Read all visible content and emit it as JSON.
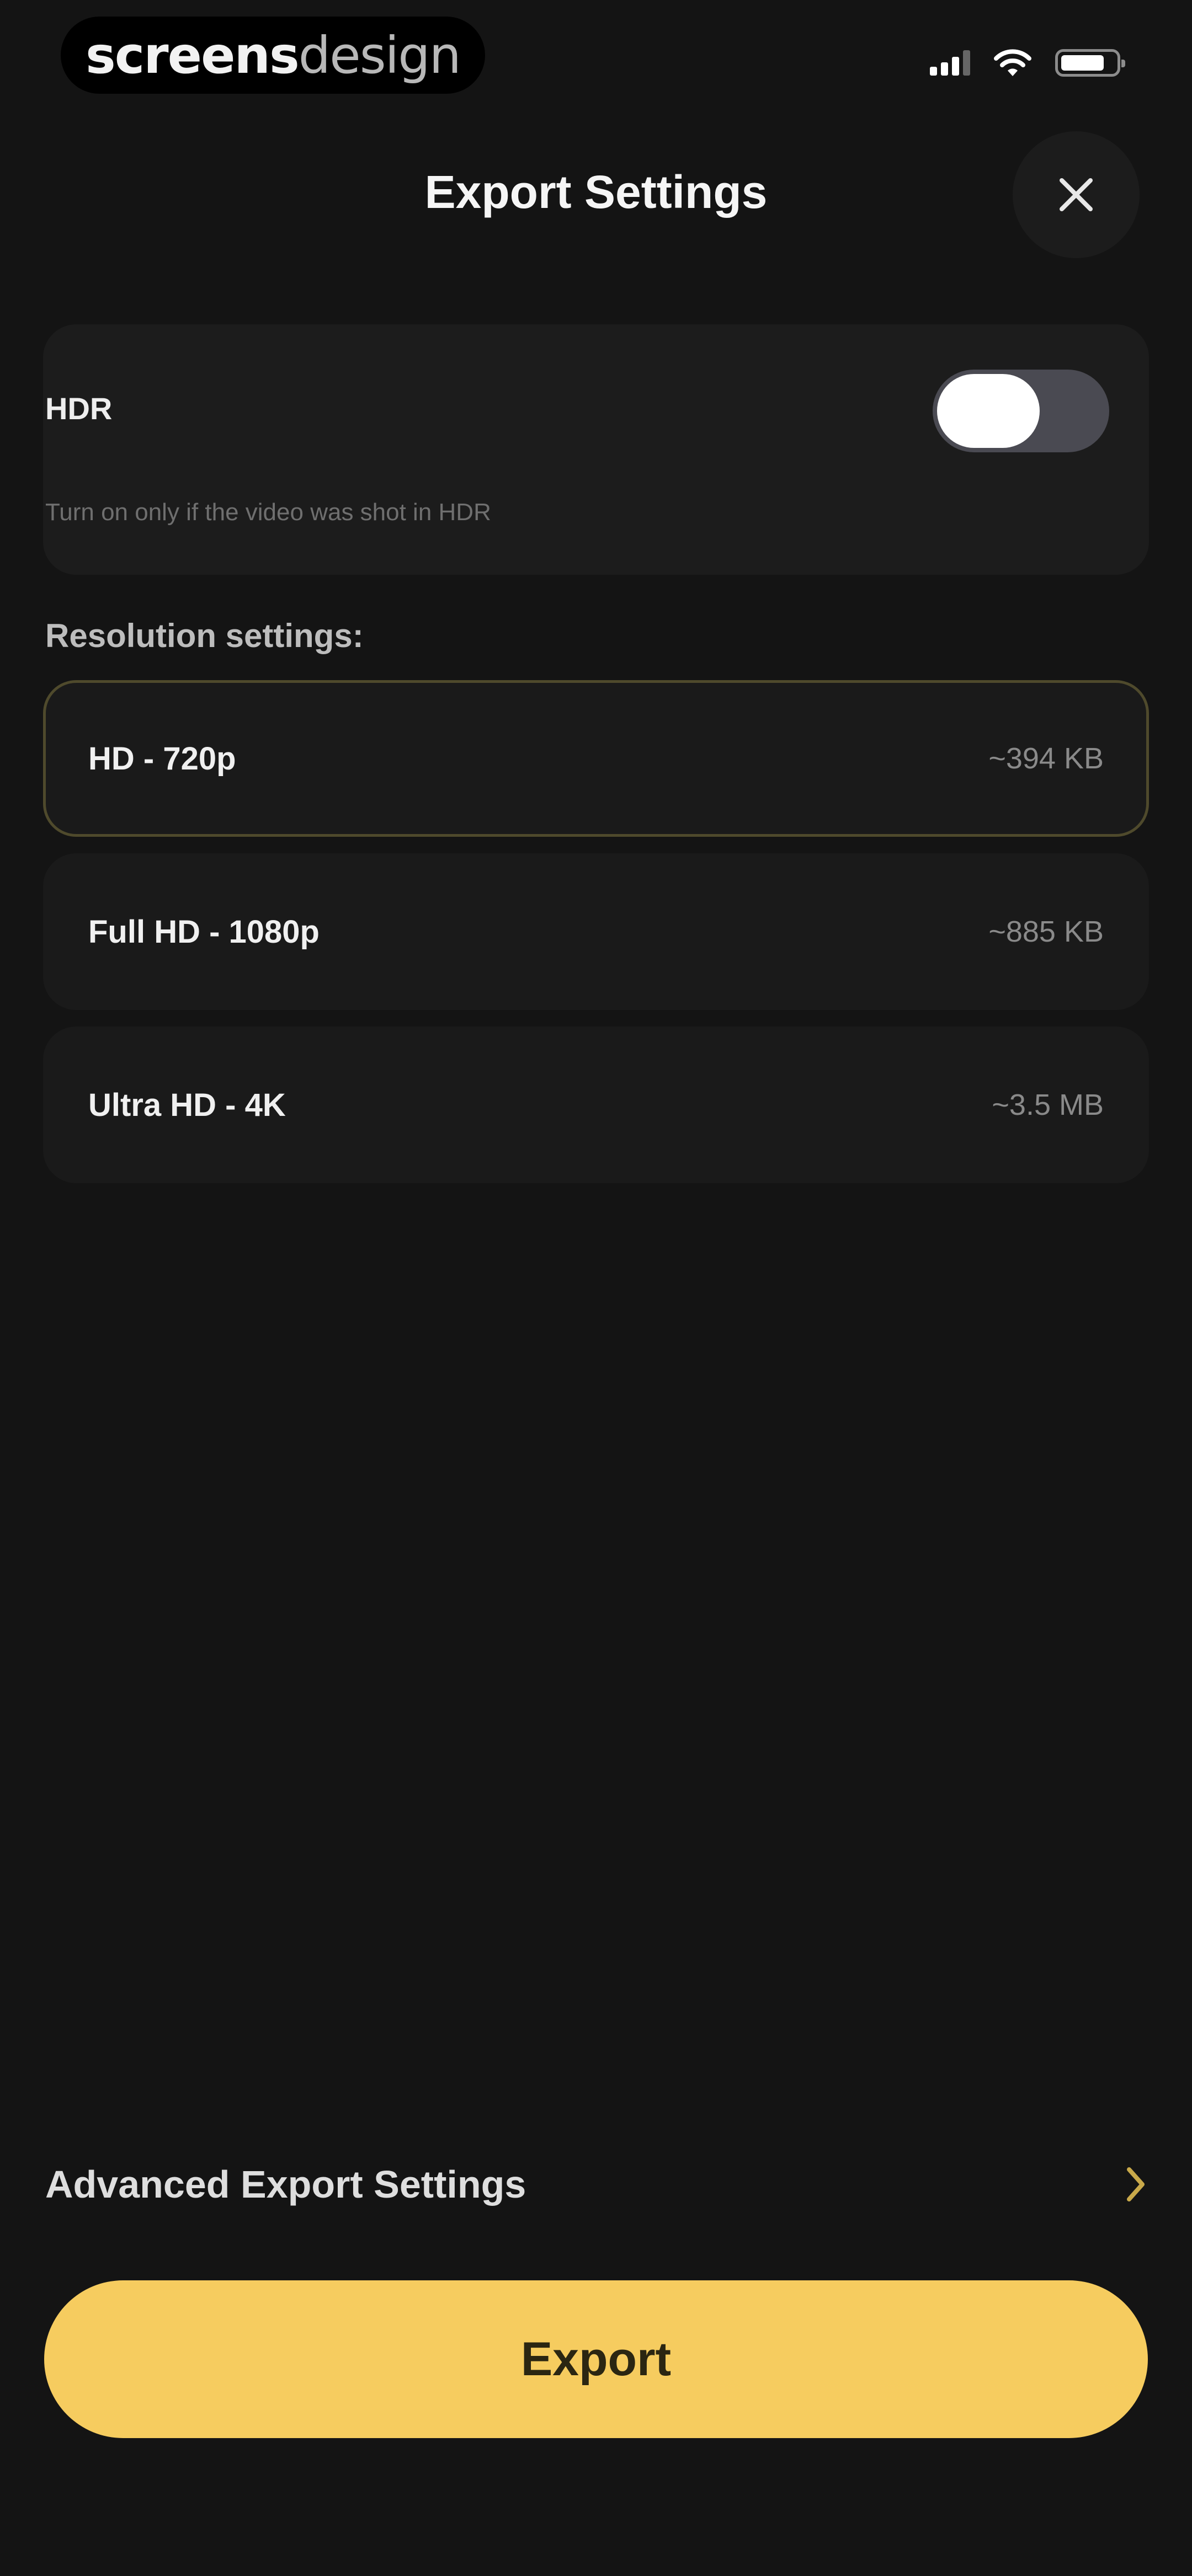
{
  "status_bar": {
    "watermark_bold": "screens",
    "watermark_light": "design",
    "icons": [
      "signal-icon",
      "wifi-icon",
      "battery-icon"
    ]
  },
  "header": {
    "title": "Export Settings",
    "close_icon": "close-icon"
  },
  "hdr": {
    "label": "HDR",
    "hint": "Turn on only if the video was shot in HDR",
    "enabled": false
  },
  "resolution": {
    "section_label": "Resolution settings:",
    "options": [
      {
        "label": "HD - 720p",
        "size": "~394 KB",
        "selected": true
      },
      {
        "label": "Full HD - 1080p",
        "size": "~885 KB",
        "selected": false
      },
      {
        "label": "Ultra HD - 4K",
        "size": "~3.5 MB",
        "selected": false
      }
    ]
  },
  "advanced": {
    "label": "Advanced Export Settings",
    "icon": "chevron-right-icon"
  },
  "export_button": {
    "label": "Export"
  },
  "colors": {
    "background": "#141414",
    "card": "#1c1c1c",
    "accent": "#f6cc5f",
    "selected_border": "#4f4a2c"
  }
}
